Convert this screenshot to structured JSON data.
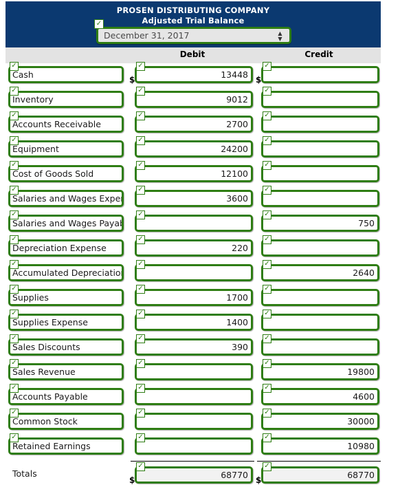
{
  "header": {
    "company": "PROSEN DISTRIBUTING COMPANY",
    "statement": "Adjusted Trial Balance",
    "date_select": {
      "value": "December 31, 2017",
      "spinner_up": "▲",
      "spinner_down": "▼"
    },
    "check_glyph": "✓"
  },
  "columns": {
    "account": "",
    "debit": "Debit",
    "credit": "Credit"
  },
  "currency_symbol": "$",
  "rows": [
    {
      "account": "Cash",
      "debit": "13448",
      "credit": ""
    },
    {
      "account": "Inventory",
      "debit": "9012",
      "credit": ""
    },
    {
      "account": "Accounts Receivable",
      "debit": "2700",
      "credit": ""
    },
    {
      "account": "Equipment",
      "debit": "24200",
      "credit": ""
    },
    {
      "account": "Cost of Goods Sold",
      "debit": "12100",
      "credit": ""
    },
    {
      "account": "Salaries and Wages Expense",
      "debit": "3600",
      "credit": ""
    },
    {
      "account": "Salaries and Wages Payable",
      "debit": "",
      "credit": "750"
    },
    {
      "account": "Depreciation Expense",
      "debit": "220",
      "credit": ""
    },
    {
      "account": "Accumulated Depreciation-Equipment",
      "debit": "",
      "credit": "2640"
    },
    {
      "account": "Supplies",
      "debit": "1700",
      "credit": ""
    },
    {
      "account": "Supplies Expense",
      "debit": "1400",
      "credit": ""
    },
    {
      "account": "Sales Discounts",
      "debit": "390",
      "credit": ""
    },
    {
      "account": "Sales Revenue",
      "debit": "",
      "credit": "19800"
    },
    {
      "account": "Accounts Payable",
      "debit": "",
      "credit": "4600"
    },
    {
      "account": "Common Stock",
      "debit": "",
      "credit": "30000"
    },
    {
      "account": "Retained Earnings",
      "debit": "",
      "credit": "10980"
    }
  ],
  "totals": {
    "label": "Totals",
    "debit": "68770",
    "credit": "68770"
  },
  "colors": {
    "banner_blue": "#0b3970",
    "field_green": "#2e7d13",
    "header_strip": "#e3e3e3"
  }
}
